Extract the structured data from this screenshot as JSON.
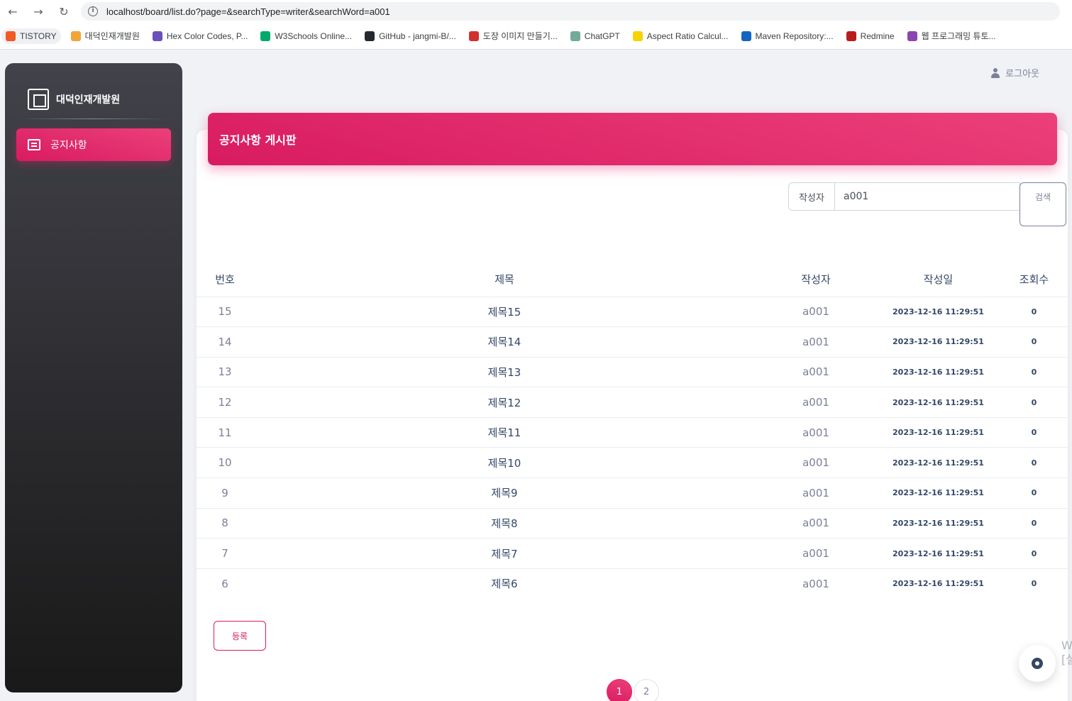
{
  "browser": {
    "url": "localhost/board/list.do?page=&searchType=writer&searchWord=a001",
    "back_icon": "←",
    "forward_icon": "→",
    "reload_icon": "↻",
    "bookmarks": [
      {
        "label": "TISTORY",
        "color": "#f15a24"
      },
      {
        "label": "대덕인재개발원",
        "color": "#f0a53b"
      },
      {
        "label": "Hex Color Codes, P...",
        "color": "#6b4fbb"
      },
      {
        "label": "W3Schools Online...",
        "color": "#04aa6d"
      },
      {
        "label": "GitHub - jangmi-B/...",
        "color": "#24292f"
      },
      {
        "label": "도장 이미지 만들기...",
        "color": "#d32f2f"
      },
      {
        "label": "ChatGPT",
        "color": "#74aa9c"
      },
      {
        "label": "Aspect Ratio Calcul...",
        "color": "#f5d300"
      },
      {
        "label": "Maven Repository:...",
        "color": "#1565c0"
      },
      {
        "label": "Redmine",
        "color": "#b71c1c"
      },
      {
        "label": "웹 프로그래밍 튜토...",
        "color": "#8e44ad"
      }
    ]
  },
  "sidebar": {
    "brand": "대덕인재개발원",
    "items": [
      {
        "label": "공지사항",
        "active": true
      }
    ]
  },
  "header": {
    "logout": "로그아웃"
  },
  "board": {
    "title": "공지사항 게시판",
    "search": {
      "type": "작성자",
      "word": "a001",
      "button": "검색"
    },
    "columns": [
      "번호",
      "제목",
      "작성자",
      "작성일",
      "조회수"
    ],
    "rows": [
      {
        "no": "15",
        "title": "제목15",
        "writer": "a001",
        "date": "2023-12-16 11:29:51",
        "hits": "0"
      },
      {
        "no": "14",
        "title": "제목14",
        "writer": "a001",
        "date": "2023-12-16 11:29:51",
        "hits": "0"
      },
      {
        "no": "13",
        "title": "제목13",
        "writer": "a001",
        "date": "2023-12-16 11:29:51",
        "hits": "0"
      },
      {
        "no": "12",
        "title": "제목12",
        "writer": "a001",
        "date": "2023-12-16 11:29:51",
        "hits": "0"
      },
      {
        "no": "11",
        "title": "제목11",
        "writer": "a001",
        "date": "2023-12-16 11:29:51",
        "hits": "0"
      },
      {
        "no": "10",
        "title": "제목10",
        "writer": "a001",
        "date": "2023-12-16 11:29:51",
        "hits": "0"
      },
      {
        "no": "9",
        "title": "제목9",
        "writer": "a001",
        "date": "2023-12-16 11:29:51",
        "hits": "0"
      },
      {
        "no": "8",
        "title": "제목8",
        "writer": "a001",
        "date": "2023-12-16 11:29:51",
        "hits": "0"
      },
      {
        "no": "7",
        "title": "제목7",
        "writer": "a001",
        "date": "2023-12-16 11:29:51",
        "hits": "0"
      },
      {
        "no": "6",
        "title": "제목6",
        "writer": "a001",
        "date": "2023-12-16 11:29:51",
        "hits": "0"
      }
    ],
    "register": "등록",
    "pages": [
      {
        "label": "1",
        "active": true
      },
      {
        "label": "2",
        "active": false
      }
    ]
  },
  "colors": {
    "accent": "#e91e63",
    "sidebar_dark": "#191919"
  }
}
